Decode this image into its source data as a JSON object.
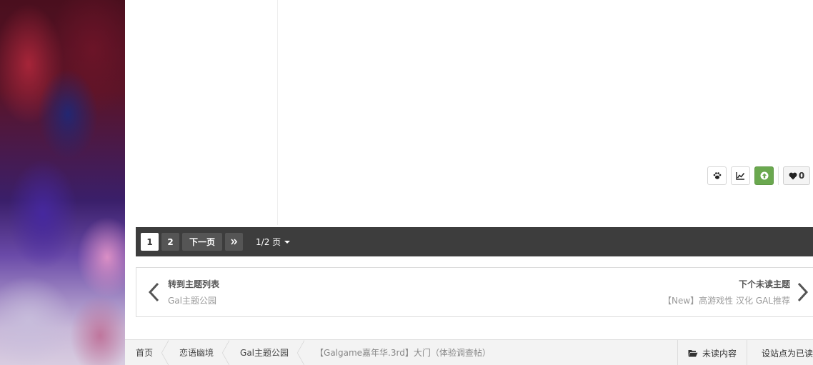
{
  "post_actions": {
    "buttons": [
      {
        "icon": "paw-icon"
      },
      {
        "icon": "chart-line-icon"
      },
      {
        "icon": "arrow-up-icon",
        "color": "#6aa84f"
      }
    ],
    "like_count": "0"
  },
  "pagination": {
    "pages": [
      "1",
      "2"
    ],
    "current_page": "1",
    "next_label": "下一页",
    "last_icon": "double-chevron-right-icon",
    "jump_label": "1/2 页"
  },
  "topic_nav": {
    "prev": {
      "title": "转到主题列表",
      "subtitle": "Gal主题公园"
    },
    "next": {
      "title": "下个未读主题",
      "subtitle": "【New】高游戏性 汉化 GAL推荐"
    }
  },
  "breadcrumb": {
    "items": [
      "首页",
      "恋语幽境",
      "Gal主题公园"
    ],
    "current": "【Galgame嘉年华.3rd】大门（体验调查帖）",
    "unread_label": "未读内容",
    "mark_read_label": "设站点为已读"
  },
  "colors": {
    "accent_green": "#6aa84f",
    "pagebar_bg": "#3d3d3d"
  }
}
